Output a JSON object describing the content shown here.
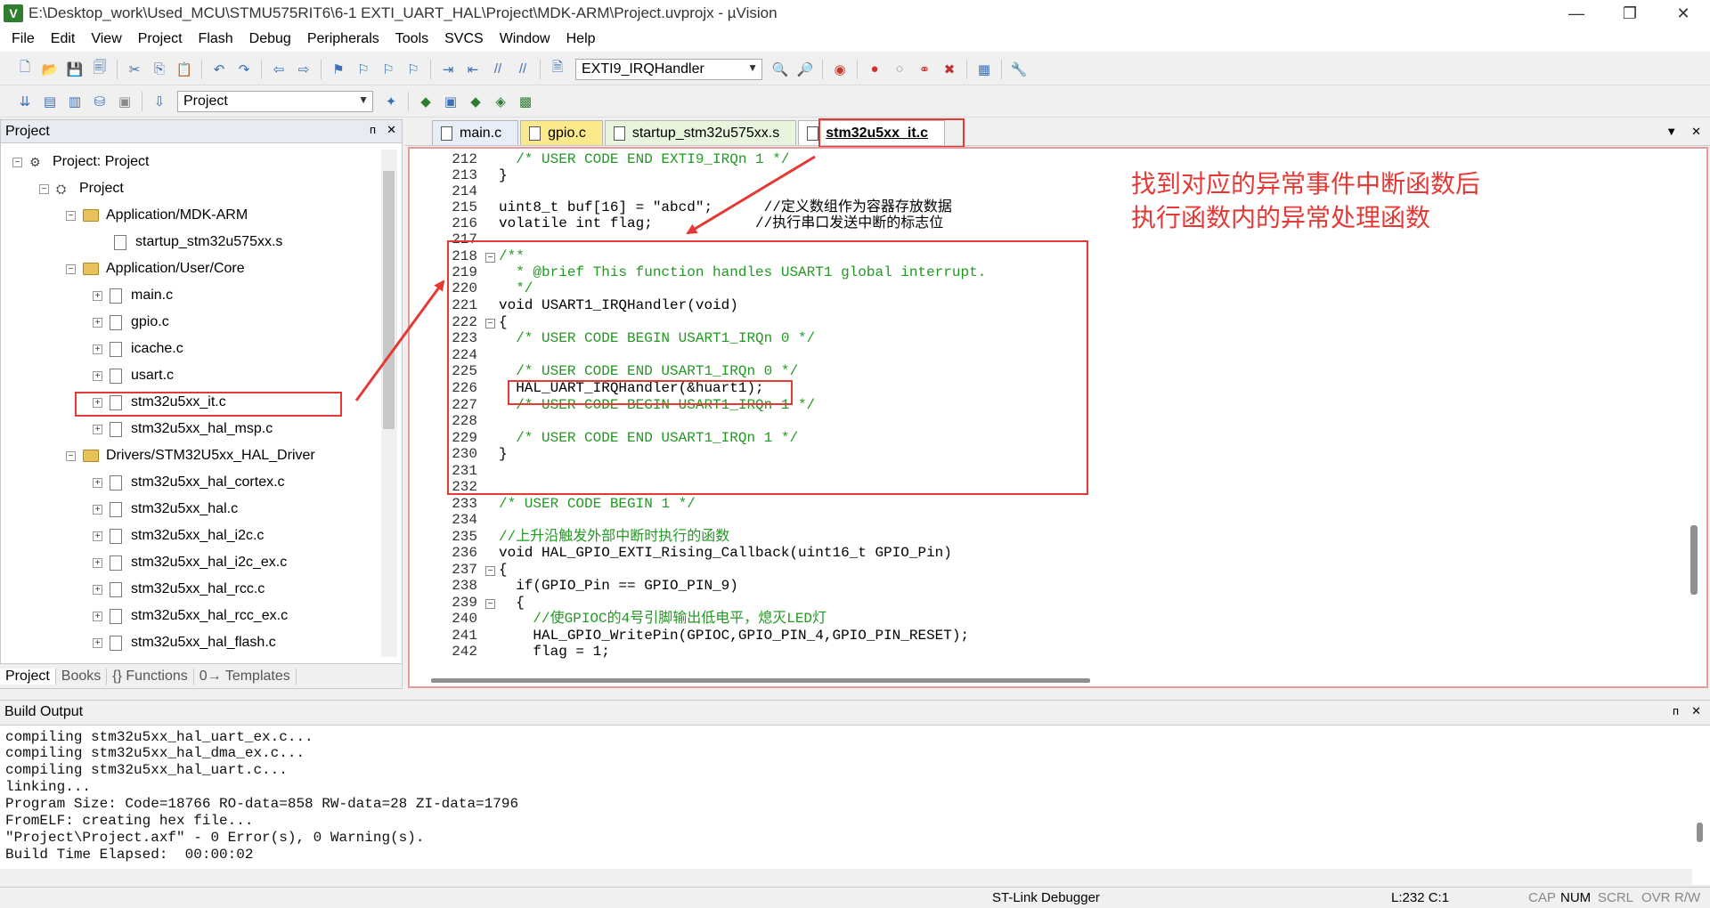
{
  "window": {
    "title": "E:\\Desktop_work\\Used_MCU\\STMU575RIT6\\6-1 EXTI_UART_HAL\\Project\\MDK-ARM\\Project.uvprojx - µVision",
    "app_icon": "V",
    "controls": [
      "—",
      "❐",
      "✕"
    ]
  },
  "menu": [
    "File",
    "Edit",
    "View",
    "Project",
    "Flash",
    "Debug",
    "Peripherals",
    "Tools",
    "SVCS",
    "Window",
    "Help"
  ],
  "toolbar": {
    "function_combo": "EXTI9_IRQHandler",
    "target_combo": "Project"
  },
  "project_panel": {
    "header": "Project",
    "pin": "ᴨ",
    "close": "✕",
    "tree": [
      {
        "label": "Project: Project",
        "kind": "root"
      },
      {
        "label": "Project",
        "kind": "target"
      },
      {
        "label": "Application/MDK-ARM",
        "kind": "folder"
      },
      {
        "label": "startup_stm32u575xx.s",
        "kind": "file"
      },
      {
        "label": "Application/User/Core",
        "kind": "folder"
      },
      {
        "label": "main.c",
        "kind": "file"
      },
      {
        "label": "gpio.c",
        "kind": "file"
      },
      {
        "label": "icache.c",
        "kind": "file"
      },
      {
        "label": "usart.c",
        "kind": "file"
      },
      {
        "label": "stm32u5xx_it.c",
        "kind": "file"
      },
      {
        "label": "stm32u5xx_hal_msp.c",
        "kind": "file"
      },
      {
        "label": "Drivers/STM32U5xx_HAL_Driver",
        "kind": "folder"
      },
      {
        "label": "stm32u5xx_hal_cortex.c",
        "kind": "file"
      },
      {
        "label": "stm32u5xx_hal.c",
        "kind": "file"
      },
      {
        "label": "stm32u5xx_hal_i2c.c",
        "kind": "file"
      },
      {
        "label": "stm32u5xx_hal_i2c_ex.c",
        "kind": "file"
      },
      {
        "label": "stm32u5xx_hal_rcc.c",
        "kind": "file"
      },
      {
        "label": "stm32u5xx_hal_rcc_ex.c",
        "kind": "file"
      },
      {
        "label": "stm32u5xx_hal_flash.c",
        "kind": "file"
      }
    ],
    "bottom_tabs": [
      "Project",
      "Books",
      "{} Functions",
      "0→ Templates"
    ]
  },
  "editor": {
    "tabs": [
      "main.c",
      "gpio.c",
      "startup_stm32u575xx.s",
      "stm32u5xx_it.c"
    ],
    "active_tab": "stm32u5xx_it.c",
    "tab_menu": "▼",
    "tab_close": "✕",
    "line_numbers": [
      "212",
      "213",
      "214",
      "215",
      "216",
      "217",
      "218",
      "219",
      "220",
      "221",
      "222",
      "223",
      "224",
      "225",
      "226",
      "227",
      "228",
      "229",
      "230",
      "231",
      "232",
      "233",
      "234",
      "235",
      "236",
      "237",
      "238",
      "239",
      "240",
      "241",
      "242"
    ],
    "lines": [
      "  /* USER CODE END EXTI9_IRQn 1 */",
      "}",
      "",
      "uint8_t buf[16] = \"abcd\";      //定义数组作为容器存放数据",
      "volatile int flag;            //执行串口发送中断的标志位",
      "",
      "/**",
      "  * @brief This function handles USART1 global interrupt.",
      "  */",
      "void USART1_IRQHandler(void)",
      "{",
      "  /* USER CODE BEGIN USART1_IRQn 0 */",
      "",
      "  /* USER CODE END USART1_IRQn 0 */",
      "  HAL_UART_IRQHandler(&huart1);",
      "  /* USER CODE BEGIN USART1_IRQn 1 */",
      "",
      "  /* USER CODE END USART1_IRQn 1 */",
      "}",
      "",
      "",
      "/* USER CODE BEGIN 1 */",
      "",
      "//上升沿触发外部中断时执行的函数",
      "void HAL_GPIO_EXTI_Rising_Callback(uint16_t GPIO_Pin)",
      "{",
      "  if(GPIO_Pin == GPIO_PIN_9)",
      "  {",
      "    //使GPIOC的4号引脚输出低电平，熄灭LED灯",
      "    HAL_GPIO_WritePin(GPIOC,GPIO_PIN_4,GPIO_PIN_RESET);",
      "    flag = 1;"
    ],
    "annotation": [
      "找到对应的异常事件中断函数后",
      "执行函数内的异常处理函数"
    ]
  },
  "build_output": {
    "header": "Build Output",
    "lines": [
      "compiling stm32u5xx_hal_uart_ex.c...",
      "compiling stm32u5xx_hal_dma_ex.c...",
      "compiling stm32u5xx_hal_uart.c...",
      "linking...",
      "Program Size: Code=18766 RO-data=858 RW-data=28 ZI-data=1796",
      "FromELF: creating hex file...",
      "\"Project\\Project.axf\" - 0 Error(s), 0 Warning(s).",
      "Build Time Elapsed:  00:00:02"
    ]
  },
  "status_bar": {
    "debugger": "ST-Link Debugger",
    "position": "L:232 C:1",
    "indicators": [
      "CAP",
      "NUM",
      "SCRL",
      "OVR",
      "R/W"
    ]
  },
  "colors": {
    "highlight_red": "#e53935",
    "comment_green": "#229922",
    "keyword_blue": "#1a33cc",
    "string_purple": "#8b008b"
  }
}
